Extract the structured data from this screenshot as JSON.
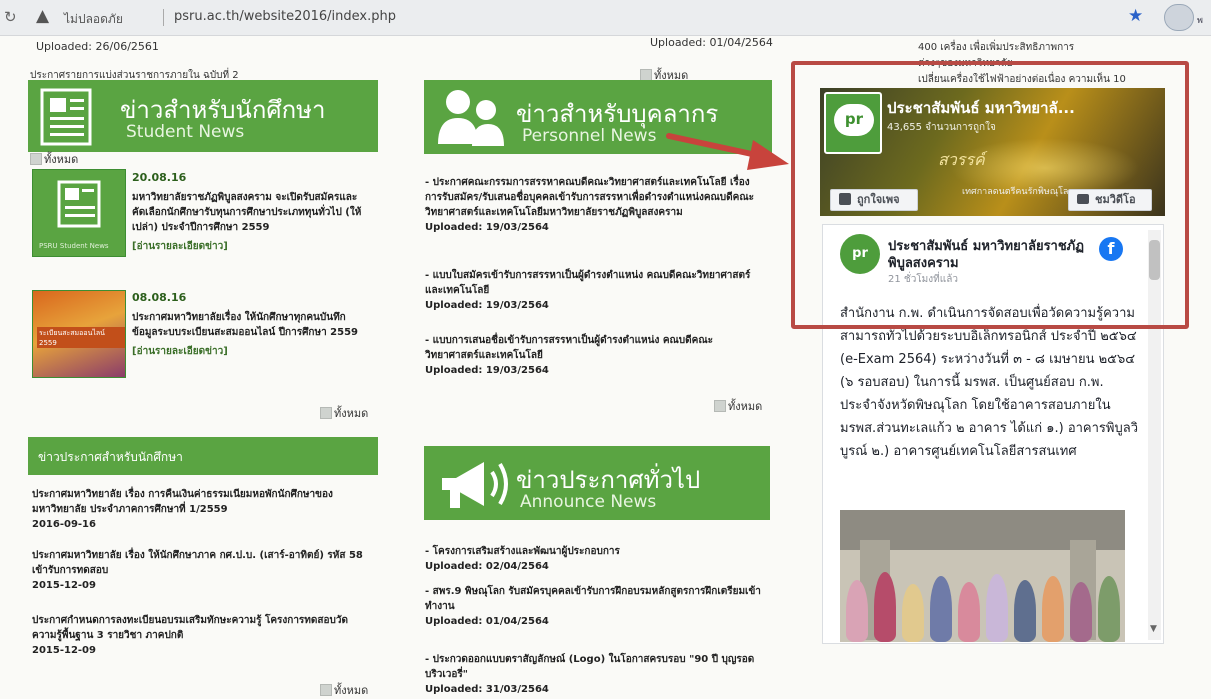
{
  "browser": {
    "insecure_label": "ไม่ปลอดภัย",
    "url": "psru.ac.th/website2016/index.php",
    "avatar_text": "พ"
  },
  "top_fragments": {
    "uploaded_left": "Uploaded: 26/06/2561",
    "uploaded_mid": "Uploaded: 01/04/2564",
    "right_line1": "400  เครื่อง  เพื่อเพิ่มประสิทธิภาพการ",
    "right_line2": "ต่างๆของมหาวิทยาลัย",
    "right_line3": "เปลี่ยนเครื่องใช้ไฟฟ้าอย่างต่อเนื่อง  ความเห็น  10",
    "announce_line": "ประกาศรายการแบ่งส่วนราชการภายใน ฉบับที่ 2",
    "more_mid_top": "ทั้งหมด"
  },
  "student_news": {
    "title_th": "ข่าวสำหรับนักศึกษา",
    "title_en": "Student News",
    "more_label": "ทั้งหมด",
    "items": [
      {
        "date": "20.08.16",
        "text": "มหาวิทยาลัยราชภัฏพิบูลสงคราม จะเปิดรับสมัครและคัดเลือกนักศึกษารับทุนการศึกษาประเภททุนทั่วไป (ให้เปล่า) ประจำปีการศึกษา 2559",
        "link": "[อ่านรายละเอียดข่าว]",
        "thumb_caption": "PSRU Student News"
      },
      {
        "date": "08.08.16",
        "text": "ประกาศมหาวิทยาลัยเรื่อง ให้นักศึกษาทุกคนบันทึกข้อมูลระบบระเบียนสะสมออนไลน์ ปีการศึกษา 2559",
        "link": "[อ่านรายละเอียดข่าว]",
        "thumb_caption": "ระเบียนสะสมออนไลน์ 2559"
      }
    ],
    "more_bottom": "ทั้งหมด"
  },
  "student_announcements": {
    "title": "ข่าวประกาศสำหรับนักศึกษา",
    "items": [
      {
        "text": "ประกาศมหาวิทยาลัย เรื่อง การคืนเงินค่าธรรมเนียมหอพักนักศึกษาของมหาวิทยาลัย ประจำภาคการศึกษาที่ 1/2559",
        "date": "2016-09-16"
      },
      {
        "text": "ประกาศมหาวิทยาลัย เรื่อง ให้นักศึกษาภาค กศ.ป.บ. (เสาร์-อาทิตย์) รหัส 58 เข้ารับการทดสอบ",
        "date": "2015-12-09"
      },
      {
        "text": "ประกาศกำหนดการลงทะเบียนอบรมเสริมทักษะความรู้ โครงการทดสอบวัดความรู้พื้นฐาน 3 รายวิชา ภาคปกติ",
        "date": "2015-12-09"
      }
    ],
    "more_label": "ทั้งหมด"
  },
  "personnel_news": {
    "title_th": "ข่าวสำหรับบุคลากร",
    "title_en": "Personnel News",
    "items": [
      {
        "text": "- ประกาศคณะกรรมการสรรหาคณบดีคณะวิทยาศาสตร์และเทคโนโลยี เรื่อง การรับสมัคร/รับเสนอชื่อบุคคลเข้ารับการสรรหาเพื่อดำรงตำแหน่งคณบดีคณะวิทยาศาสตร์และเทคโนโลยีมหาวิทยาลัยราชภัฏพิบูลสงคราม",
        "uploaded": "Uploaded: 19/03/2564"
      },
      {
        "text": "- แบบใบสมัครเข้ารับการสรรหาเป็นผู้ดำรงตำแหน่ง คณบดีคณะวิทยาศาสตร์และเทคโนโลยี",
        "uploaded": "Uploaded: 19/03/2564"
      },
      {
        "text": "- แบบการเสนอชื่อเข้ารับการสรรหาเป็นผู้ดำรงตำแหน่ง คณบดีคณะวิทยาศาสตร์และเทคโนโลยี",
        "uploaded": "Uploaded: 19/03/2564"
      }
    ],
    "more_label": "ทั้งหมด"
  },
  "announce_news": {
    "title_th": "ข่าวประกาศทั่วไป",
    "title_en": "Announce News",
    "items": [
      {
        "text": "- โครงการเสริมสร้างและพัฒนาผู้ประกอบการ",
        "uploaded": "Uploaded: 02/04/2564"
      },
      {
        "text": "- สพร.9 พิษณุโลก รับสมัครบุคคลเข้ารับการฝึกอบรมหลักสูตรการฝึกเตรียมเข้าทำงาน",
        "uploaded": "Uploaded: 01/04/2564"
      },
      {
        "text": "- ประกวดออกแบบตราสัญลักษณ์ (Logo) ในโอกาสครบรอบ \"90 ปี บุญรอดบริวเวอรี่\"",
        "uploaded": "Uploaded: 31/03/2564"
      }
    ]
  },
  "facebook": {
    "page_name": "ประชาสัมพันธ์ มหาวิทยาลั...",
    "likes": "43,655 จำนวนการถูกใจ",
    "cover_text": "สวรรค์",
    "cover_subtext": "เทศกาลดนตรีคนรักพิษณุโลก",
    "like_button": "ถูกใจเพจ",
    "video_button": "ชมวิดีโอ",
    "logo_text": "pr",
    "post_name": "ประชาสัมพันธ์ มหาวิทยาลัยราชภัฏพิบูลสงคราม",
    "post_time": "21 ชั่วโมงที่แล้ว",
    "post_body": "สำนักงาน ก.พ. ดำเนินการจัดสอบเพื่อวัดความรู้ความสามารถทั่วไปด้วยระบบอิเล็กทรอนิกส์ ประจำปี ๒๕๖๔ (e-Exam 2564) ระหว่างวันที่ ๓ - ๘ เมษายน ๒๕๖๔ (๖ รอบสอบ) ในการนี้ มรพส. เป็นศูนย์สอบ ก.พ. ประจำจังหวัดพิษณุโลก โดยใช้อาคารสอบภายใน มรพส.ส่วนทะเลแก้ว ๒ อาคาร ได้แก่ ๑.) อาคารพิบูลวิบูรณ์ ๒.) อาคารศูนย์เทคโนโลยีสารสนเทศ"
  },
  "colors": {
    "banner_green": "#5aa442",
    "frame_red": "#b84a44",
    "facebook_blue": "#1877f2"
  }
}
